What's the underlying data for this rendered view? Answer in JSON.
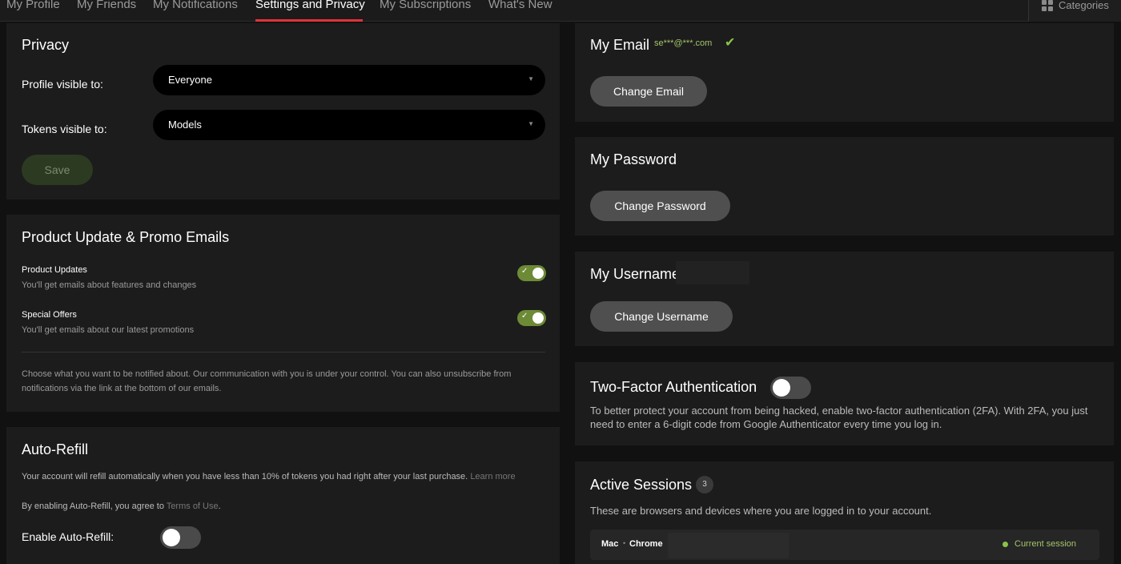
{
  "tabs": [
    {
      "label": "My Profile"
    },
    {
      "label": "My Friends"
    },
    {
      "label": "My Notifications"
    },
    {
      "label": "Settings and Privacy",
      "active": true
    },
    {
      "label": "My Subscriptions"
    },
    {
      "label": "What's New"
    }
  ],
  "categories": {
    "label": "Categories",
    "icon": "grid-icon"
  },
  "privacy": {
    "title": "Privacy",
    "profile_label": "Profile visible to:",
    "profile_value": "Everyone",
    "tokens_label": "Tokens visible to:",
    "tokens_value": "Models",
    "save_label": "Save"
  },
  "emails": {
    "title": "Product Update & Promo Emails",
    "items": [
      {
        "title": "Product Updates",
        "desc": "You'll get emails about features and changes",
        "enabled": true
      },
      {
        "title": "Special Offers",
        "desc": "You'll get emails about our latest promotions",
        "enabled": true
      }
    ],
    "note": "Choose what you want to be notified about. Our communication with you is under your control. You can also unsubscribe from notifications via the link at the bottom of our emails."
  },
  "autorefill": {
    "title": "Auto-Refill",
    "desc": "Your account will refill automatically when you have less than 10% of tokens you had right after your last purchase.",
    "learn_more": "Learn more",
    "agree_prefix": "By enabling Auto-Refill, you agree to",
    "terms": "Terms of Use",
    "agree_suffix": ".",
    "enable_label": "Enable Auto-Refill:",
    "enabled": false
  },
  "email": {
    "title": "My Email",
    "value": "se***@***.com",
    "verified_icon": "check-icon",
    "button": "Change Email"
  },
  "password": {
    "title": "My Password",
    "button": "Change Password"
  },
  "username": {
    "title": "My Username",
    "button": "Change Username"
  },
  "twofa": {
    "title": "Two-Factor Authentication",
    "enabled": false,
    "desc": "To better protect your account from being hacked, enable two-factor authentication (2FA). With 2FA, you just need to enter a 6-digit code from Google Authenticator every time you log in."
  },
  "sessions": {
    "title": "Active Sessions",
    "count": "3",
    "desc": "These are browsers and devices where you are logged in to your account.",
    "current": {
      "os": "Mac",
      "sep": "•",
      "browser": "Chrome",
      "status": "Current session"
    }
  },
  "colors": {
    "accent": "#e2323a",
    "toggle_on": "#6d8a37",
    "status_dot": "#8bc34a"
  }
}
